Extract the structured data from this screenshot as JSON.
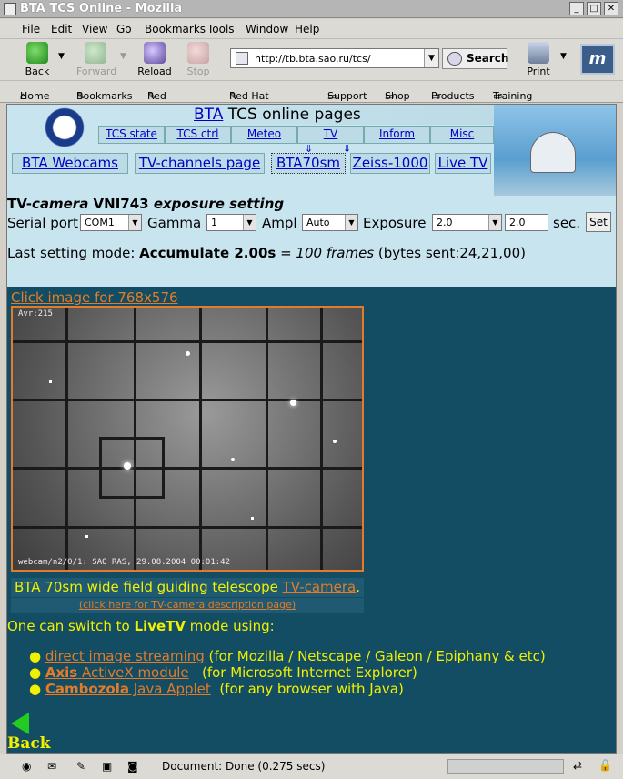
{
  "window": {
    "title": "BTA TCS Online - Mozilla"
  },
  "menu": [
    "File",
    "Edit",
    "View",
    "Go",
    "Bookmarks",
    "Tools",
    "Window",
    "Help"
  ],
  "toolbar": {
    "back": "Back",
    "forward": "Forward",
    "reload": "Reload",
    "stop": "Stop",
    "url": "http://tb.bta.sao.ru/tcs/",
    "search": "Search",
    "print": "Print"
  },
  "personal": [
    "Home",
    "Bookmarks",
    "Red Hat, Inc.",
    "Red Hat Network",
    "Support",
    "Shop",
    "Products",
    "Training"
  ],
  "page": {
    "bta": "BTA",
    "title_rest": " TCS online pages",
    "nav1": [
      "TCS state",
      "TCS ctrl",
      "Meteo",
      "TV",
      "Inform",
      "Misc"
    ],
    "nav2": [
      "BTA Webcams",
      "TV-channels page",
      "BTA70sm",
      "Zeiss-1000",
      "Live TV"
    ],
    "heading_a": "TV-",
    "heading_b": "camera",
    "heading_c": " VNI743 ",
    "heading_d": "exposure setting",
    "serial_label": "Serial port",
    "serial_val": "COM1",
    "gamma_label": "Gamma",
    "gamma_val": "1",
    "ampl_label": "Ampl",
    "ampl_val": "Auto",
    "exp_label": "Exposure",
    "exp_val": "2.0",
    "exp_input": "2.0",
    "sec": "sec.",
    "set": "Set",
    "mode_a": "Last setting mode: ",
    "mode_b": "Accumulate 2.00s",
    "mode_c": " = ",
    "mode_d": "100 frames",
    "mode_e": " (bytes sent:24,21,00)",
    "click_image": "Click image for 768x576",
    "img_avr": "Avr:215",
    "img_caption": "webcam/n2/0/1: SAO RAS, 29.08.2004 00:01:42",
    "cap_a": "BTA 70sm wide field guiding telescope ",
    "cap_link": "TV-camera",
    "cap_dot": ".",
    "cap2": "(click here for TV-camera description page)",
    "switch_a": "One can switch to ",
    "switch_b": "LiveTV",
    "switch_c": " mode using:",
    "bul1_link": "direct image streaming",
    "bul1_rest": " (for Mozilla / Netscape / Galeon / Epiphany & etc)",
    "bul2_b": "Axis",
    "bul2_link": " ActiveX module",
    "bul2_rest": "   (for Microsoft Internet Explorer)",
    "bul3_b": "Cambozola",
    "bul3_link": " Java Applet",
    "bul3_rest": "  (for any browser with Java)",
    "back": "Back"
  },
  "status": {
    "text": "Document: Done (0.275 secs)"
  }
}
